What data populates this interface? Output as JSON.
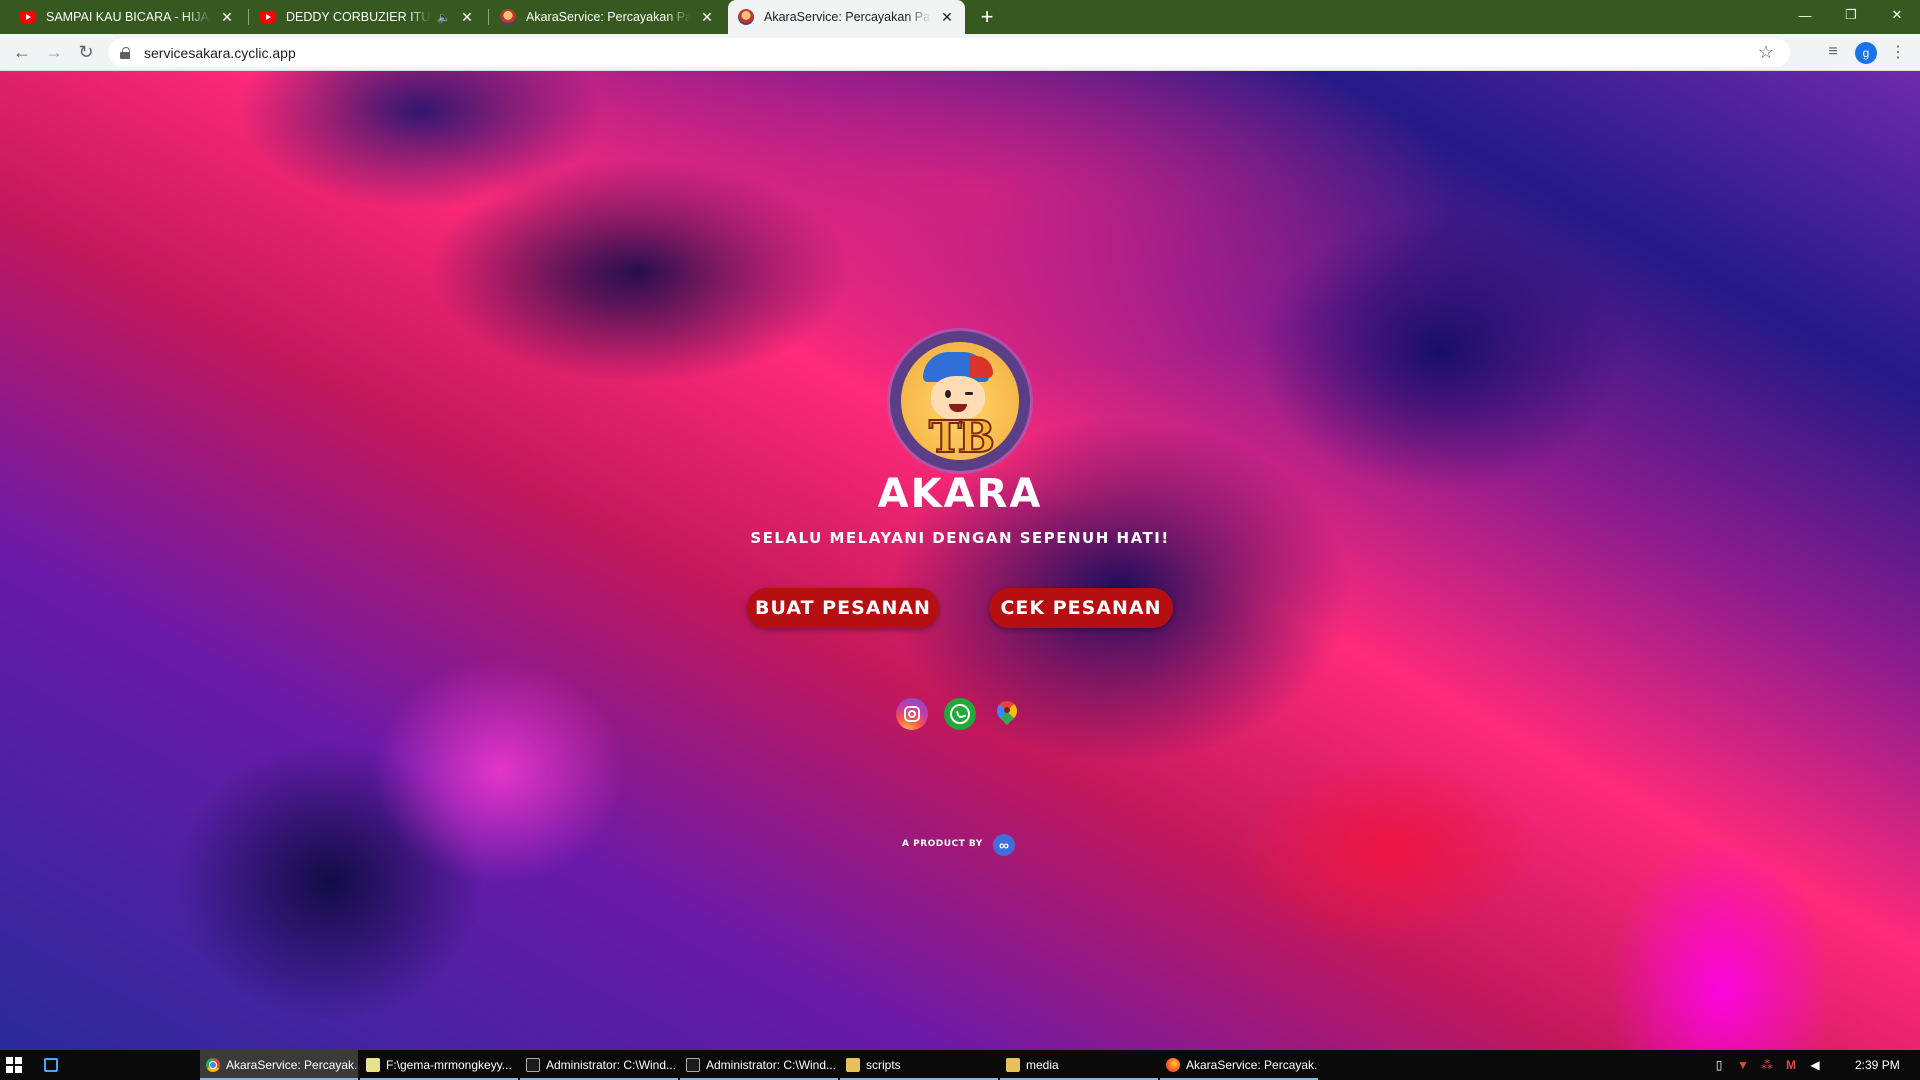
{
  "browser": {
    "tabs": [
      {
        "title": "SAMPAI KAU BICARA - HIJAU DA",
        "favicon": "youtube-icon"
      },
      {
        "title": "DEDDY CORBUZIER ITU LINT",
        "favicon": "youtube-icon",
        "audio": "speaker-icon"
      },
      {
        "title": "AkaraService: Percayakan Pada K",
        "favicon": "akara-favicon"
      },
      {
        "title": "AkaraService: Percayakan Pada K",
        "favicon": "akara-favicon",
        "active": true
      }
    ],
    "url": "servicesakara.cyclic.app",
    "profile_initial": "g",
    "tab_bar_color": "#35591f"
  },
  "page": {
    "brand": "AKARA",
    "tagline": "SELALU MELAYANI DENGAN SEPENUH HATI!",
    "buttons": {
      "buat": "BUAT PESANAN",
      "cek": "CEK PESANAN"
    },
    "button_color": "#b50f12",
    "logo_text": "TB",
    "social": [
      "instagram-icon",
      "whatsapp-icon",
      "google-maps-icon"
    ],
    "product_by": "A PRODUCT BY"
  },
  "taskbar": {
    "items": [
      {
        "label": "AkaraService: Percayak...",
        "icon": "chrome-icon",
        "active": true
      },
      {
        "label": "F:\\gema-mrmongkeyy...",
        "icon": "notepad-icon"
      },
      {
        "label": "Administrator: C:\\Wind...",
        "icon": "cmd-icon"
      },
      {
        "label": "Administrator: C:\\Wind...",
        "icon": "cmd-icon"
      },
      {
        "label": "scripts",
        "icon": "folder-icon"
      },
      {
        "label": "media",
        "icon": "folder-icon"
      },
      {
        "label": "AkaraService: Percayak...",
        "icon": "firefox-icon"
      }
    ],
    "time": "2:39 PM"
  }
}
